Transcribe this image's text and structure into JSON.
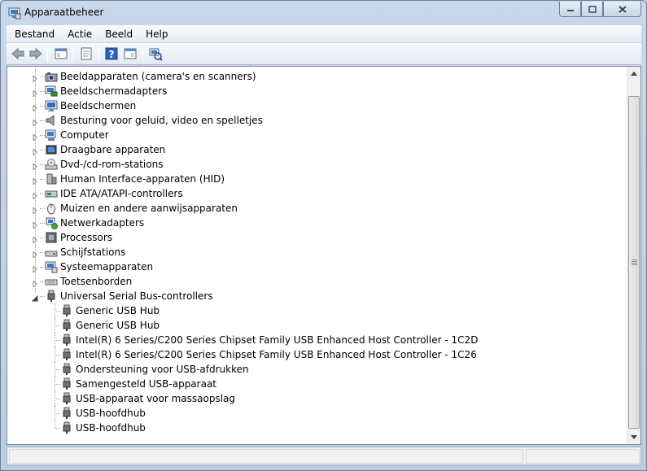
{
  "window": {
    "title": "Apparaatbeheer"
  },
  "menubar": {
    "items": [
      "Bestand",
      "Actie",
      "Beeld",
      "Help"
    ]
  },
  "toolbar": {
    "icons": [
      "back-arrow-icon",
      "forward-arrow-icon",
      "show-hide-console-tree-icon",
      "properties-icon",
      "help-icon",
      "action-pane-icon",
      "scan-hardware-icon"
    ]
  },
  "tree": {
    "categories": [
      {
        "label": "Beeldapparaten (camera's en scanners)",
        "icon": "camera-icon",
        "expanded": false
      },
      {
        "label": "Beeldschermadapters",
        "icon": "display-adapter-icon",
        "expanded": false
      },
      {
        "label": "Beeldschermen",
        "icon": "monitor-icon",
        "expanded": false
      },
      {
        "label": "Besturing voor geluid, video en spelletjes",
        "icon": "speaker-icon",
        "expanded": false
      },
      {
        "label": "Computer",
        "icon": "computer-icon",
        "expanded": false
      },
      {
        "label": "Draagbare apparaten",
        "icon": "portable-device-icon",
        "expanded": false
      },
      {
        "label": "Dvd-/cd-rom-stations",
        "icon": "optical-drive-icon",
        "expanded": false
      },
      {
        "label": "Human Interface-apparaten (HID)",
        "icon": "hid-icon",
        "expanded": false
      },
      {
        "label": "IDE ATA/ATAPI-controllers",
        "icon": "ide-controller-icon",
        "expanded": false
      },
      {
        "label": "Muizen en andere aanwijsapparaten",
        "icon": "mouse-icon",
        "expanded": false
      },
      {
        "label": "Netwerkadapters",
        "icon": "network-adapter-icon",
        "expanded": false
      },
      {
        "label": "Processors",
        "icon": "processor-icon",
        "expanded": false
      },
      {
        "label": "Schijfstations",
        "icon": "disk-drive-icon",
        "expanded": false
      },
      {
        "label": "Systeemapparaten",
        "icon": "system-device-icon",
        "expanded": false
      },
      {
        "label": "Toetsenborden",
        "icon": "keyboard-icon",
        "expanded": false
      },
      {
        "label": "Universal Serial Bus-controllers",
        "icon": "usb-plug-icon",
        "expanded": true
      }
    ],
    "usb_children": [
      "Generic USB Hub",
      "Generic USB Hub",
      "Intel(R) 6 Series/C200 Series Chipset Family USB Enhanced Host Controller - 1C2D",
      "Intel(R) 6 Series/C200 Series Chipset Family USB Enhanced Host Controller - 1C26",
      "Ondersteuning voor USB-afdrukken",
      "Samengesteld USB-apparaat",
      "USB-apparaat voor massaopslag",
      "USB-hoofdhub",
      "USB-hoofdhub"
    ]
  },
  "colors": {
    "selection": "#cce8ff",
    "window_frame": "#b8cce3",
    "tree_lines": "#a0a0a0"
  }
}
